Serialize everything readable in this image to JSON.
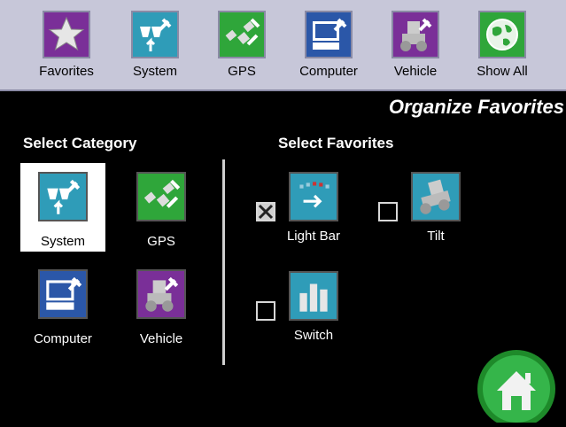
{
  "topbar": {
    "items": [
      {
        "label": "Favorites",
        "icon": "star-icon",
        "color": "#7a2f98"
      },
      {
        "label": "System",
        "icon": "system-icon",
        "color": "#2f9cb8"
      },
      {
        "label": "GPS",
        "icon": "gps-icon",
        "color": "#2fa63a"
      },
      {
        "label": "Computer",
        "icon": "computer-icon",
        "color": "#2b57a8"
      },
      {
        "label": "Vehicle",
        "icon": "vehicle-icon",
        "color": "#7a2f98"
      },
      {
        "label": "Show All",
        "icon": "globe-icon",
        "color": "#2fa63a"
      }
    ]
  },
  "page": {
    "title": "Organize Favorites"
  },
  "categories": {
    "heading": "Select Category",
    "selected": "System",
    "items": [
      {
        "label": "System",
        "icon": "system-icon",
        "color": "#2f9cb8"
      },
      {
        "label": "GPS",
        "icon": "gps-icon",
        "color": "#2fa63a"
      },
      {
        "label": "Computer",
        "icon": "computer-icon",
        "color": "#2b57a8"
      },
      {
        "label": "Vehicle",
        "icon": "vehicle-icon",
        "color": "#7a2f98"
      }
    ]
  },
  "favorites": {
    "heading": "Select Favorites",
    "items": [
      {
        "label": "Light Bar",
        "icon": "light-bar-icon",
        "checked": true,
        "color": "#2f9cb8"
      },
      {
        "label": "Tilt",
        "icon": "tilt-icon",
        "checked": false,
        "color": "#2f9cb8"
      },
      {
        "label": "Switch",
        "icon": "switch-icon",
        "checked": false,
        "color": "#2f9cb8"
      }
    ]
  },
  "home": {
    "icon": "home-icon",
    "color": "#2fa63a"
  }
}
